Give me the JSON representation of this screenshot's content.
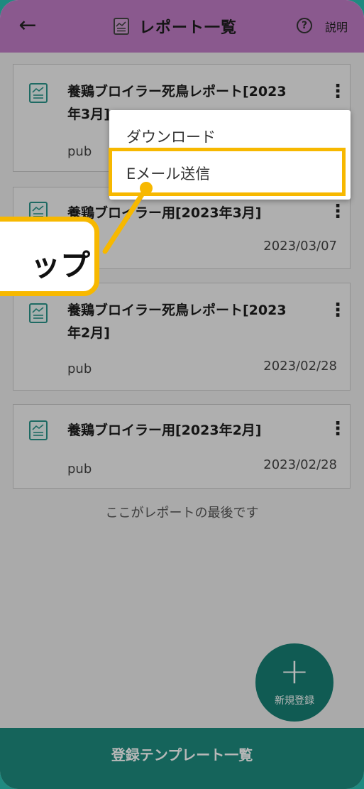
{
  "header": {
    "back_icon": "arrow-left-icon",
    "title": "レポート一覧",
    "help_label": "説明",
    "help_icon_glyph": "?",
    "background": "#c07cc5"
  },
  "reports": [
    {
      "title_line1": "養鶏ブロイラー死鳥レポート[2023",
      "title_line2": "年3月]",
      "owner": "pub",
      "date": ""
    },
    {
      "title_line1": "養鶏ブロイラー用[2023年3月]",
      "title_line2": "",
      "owner": "",
      "date": "2023/03/07"
    },
    {
      "title_line1": "養鶏ブロイラー死鳥レポート[2023",
      "title_line2": "年2月]",
      "owner": "pub",
      "date": "2023/02/28"
    },
    {
      "title_line1": "養鶏ブロイラー用[2023年2月]",
      "title_line2": "",
      "owner": "pub",
      "date": "2023/02/28"
    }
  ],
  "end_note": "ここがレポートの最後です",
  "context_menu": {
    "items": [
      "ダウンロード",
      "Eメール送信"
    ],
    "highlighted_index": 1
  },
  "callout": {
    "text": "ップ"
  },
  "fab": {
    "plus": "+",
    "label": "新規登録"
  },
  "bottom_bar": {
    "label": "登録テンプレート一覧",
    "color": "#1e8b7f"
  },
  "colors": {
    "accent": "#f7b800",
    "teal": "#177e73"
  }
}
